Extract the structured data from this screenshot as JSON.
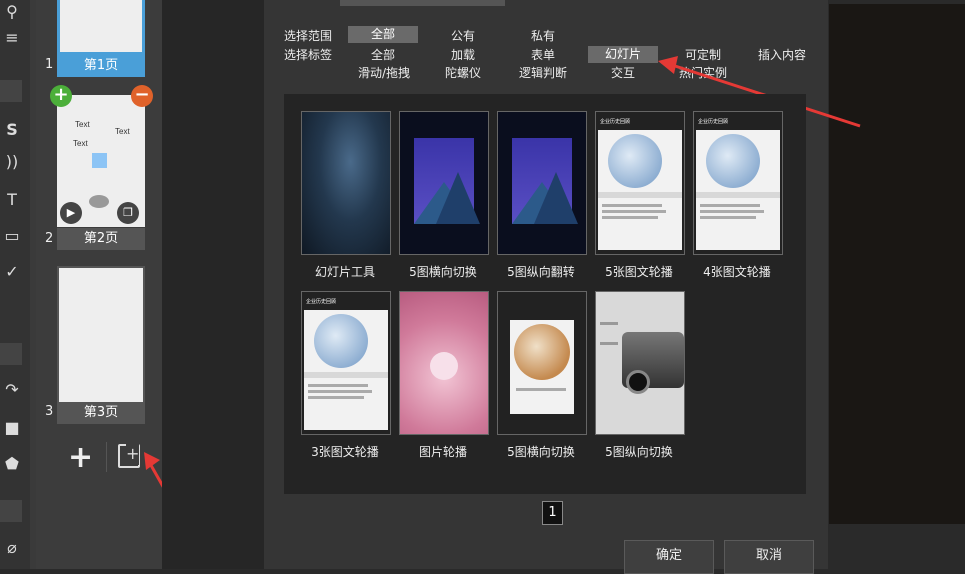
{
  "pages": [
    {
      "number": "1",
      "label": "第1页"
    },
    {
      "number": "2",
      "label": "第2页",
      "items": [
        "Text",
        "Text",
        "Text"
      ]
    },
    {
      "number": "3",
      "label": "第3页"
    }
  ],
  "page_actions": {
    "add": "+",
    "add_symbol": "+",
    "remove_symbol": "−"
  },
  "filters": {
    "scope": {
      "label": "选择范围",
      "options": [
        "全部",
        "公有",
        "私有"
      ],
      "selected": "全部"
    },
    "tags": {
      "label": "选择标签",
      "options_row1": [
        "全部",
        "加载",
        "表单",
        "幻灯片",
        "可定制",
        "插入内容"
      ],
      "options_row2": [
        "滑动/拖拽",
        "陀螺仪",
        "逻辑判断",
        "交互",
        "热门实例"
      ],
      "selected": "幻灯片"
    }
  },
  "templates": [
    {
      "name": "幻灯片工具",
      "style": "blue-texture"
    },
    {
      "name": "5图横向切换",
      "style": "night-mountain"
    },
    {
      "name": "5图纵向翻转",
      "style": "night-mountain"
    },
    {
      "name": "5张图文轮播",
      "style": "globe"
    },
    {
      "name": "4张图文轮播",
      "style": "globe"
    },
    {
      "name": "3张图文轮播",
      "style": "globe"
    },
    {
      "name": "图片轮播",
      "style": "pink-flower"
    },
    {
      "name": "5图横向切换",
      "style": "globe-people"
    },
    {
      "name": "5图纵向切换",
      "style": "car"
    }
  ],
  "card_heading": "企业历史回顾",
  "pagination": {
    "current": "1"
  },
  "buttons": {
    "confirm": "确定",
    "cancel": "取消"
  },
  "colors": {
    "accent_blue": "#4a9fd8",
    "add_green": "#4caf3a",
    "remove_orange": "#e0622a",
    "arrow_red": "#e53935"
  }
}
